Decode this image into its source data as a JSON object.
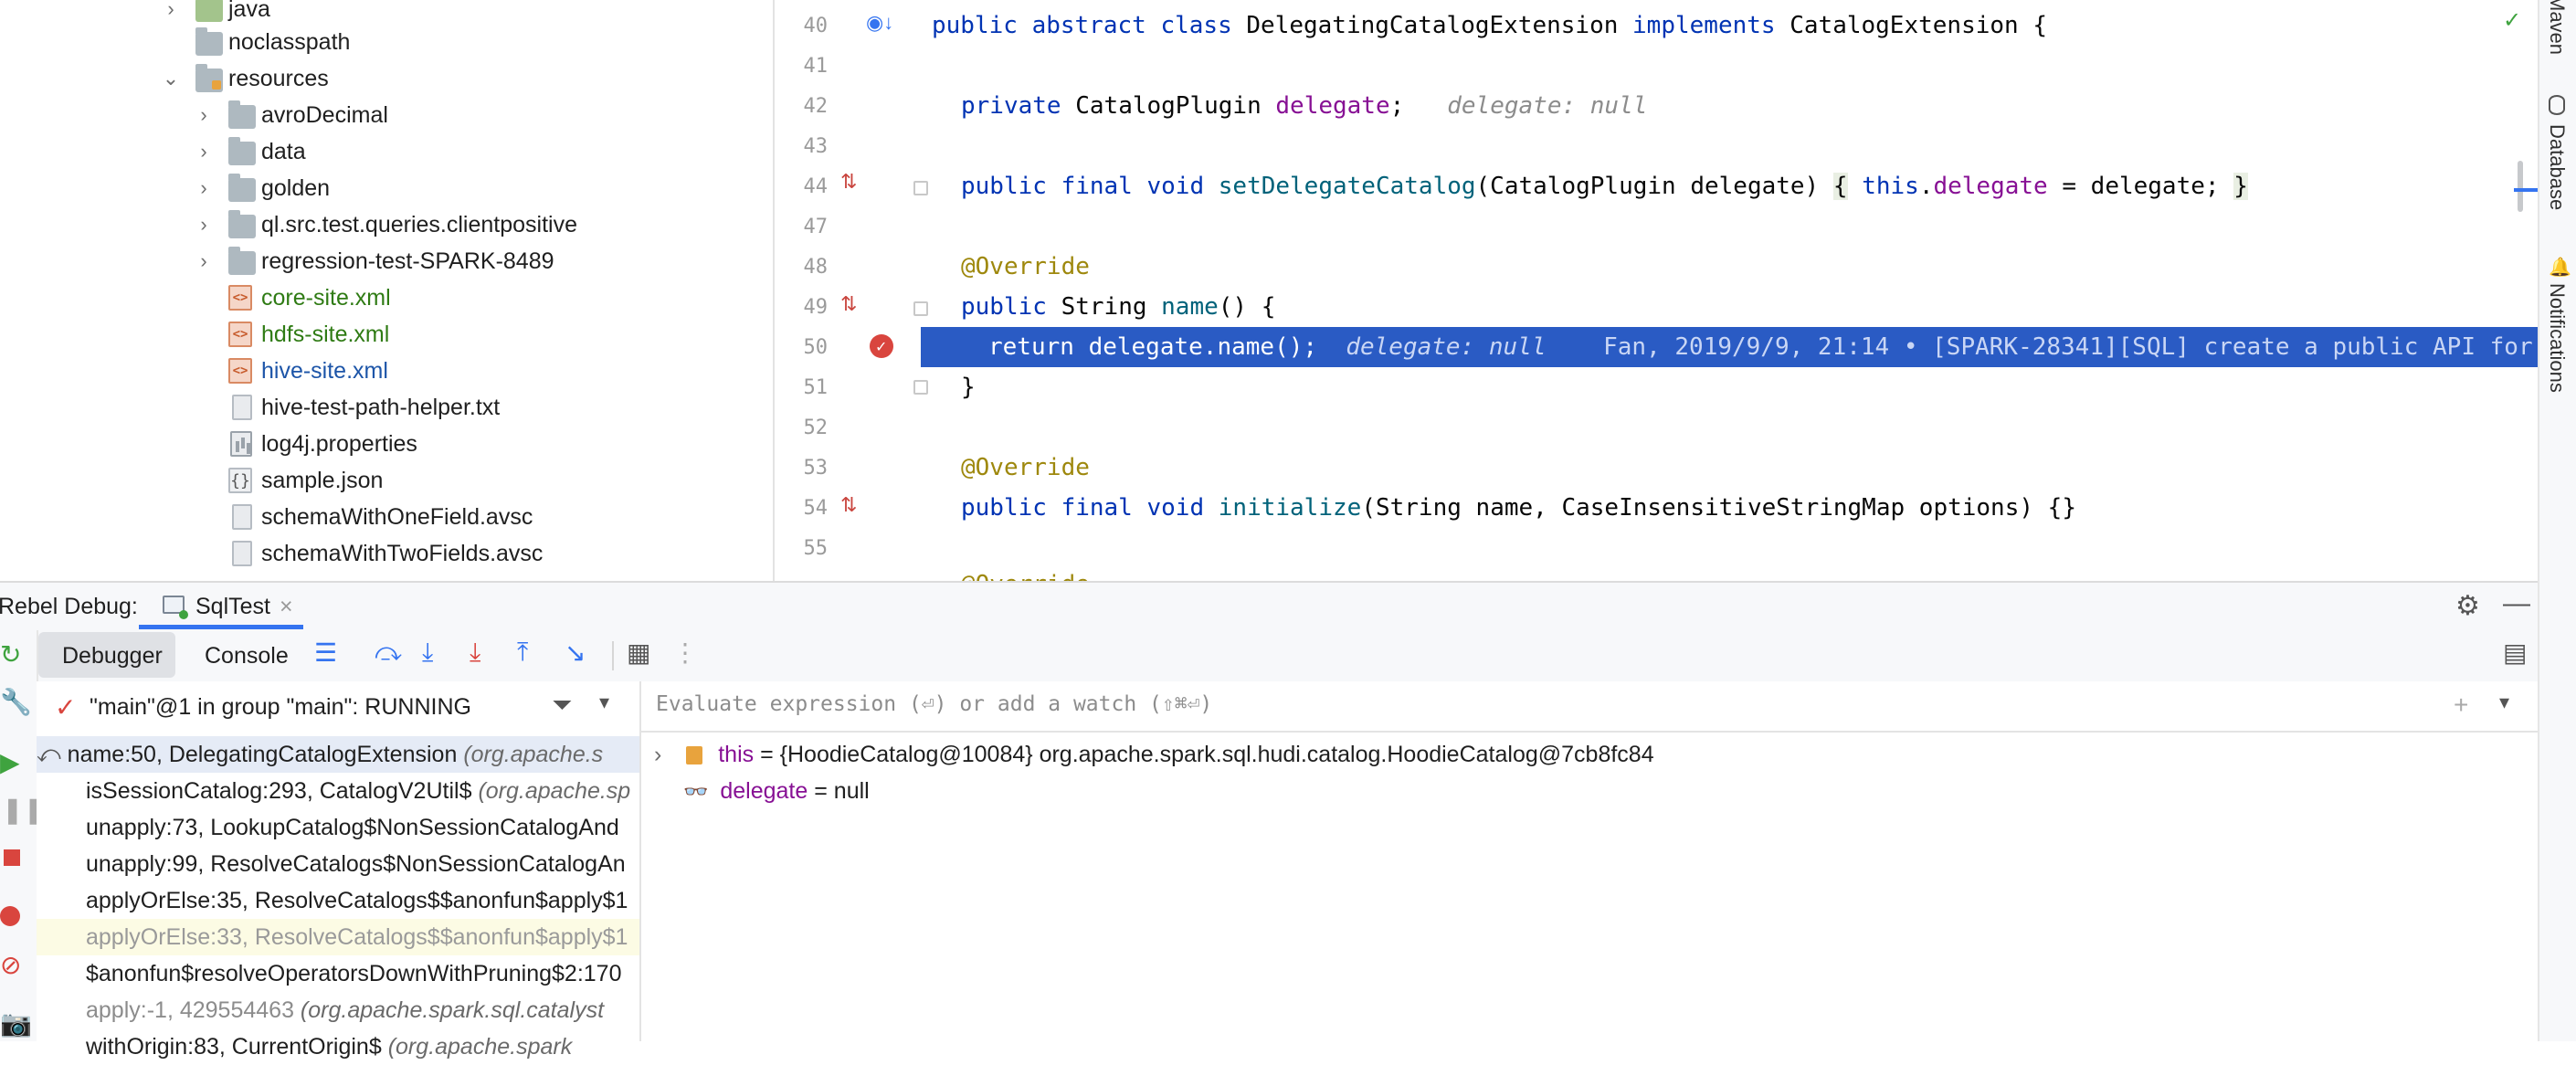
{
  "tree": {
    "items": [
      {
        "label": "java",
        "icon": "folder-green-icon",
        "chevron": "›"
      },
      {
        "label": "noclasspath",
        "icon": "folder-icon",
        "chevron": ""
      },
      {
        "label": "resources",
        "icon": "resources-folder-icon",
        "chevron": "⌄"
      },
      {
        "label": "avroDecimal",
        "icon": "folder-icon",
        "chevron": "›"
      },
      {
        "label": "data",
        "icon": "folder-icon",
        "chevron": "›"
      },
      {
        "label": "golden",
        "icon": "folder-icon",
        "chevron": "›"
      },
      {
        "label": "ql.src.test.queries.clientpositive",
        "icon": "folder-icon",
        "chevron": "›"
      },
      {
        "label": "regression-test-SPARK-8489",
        "icon": "folder-icon",
        "chevron": "›"
      },
      {
        "label": "core-site.xml",
        "icon": "xml-file-icon",
        "chevron": ""
      },
      {
        "label": "hdfs-site.xml",
        "icon": "xml-file-icon",
        "chevron": ""
      },
      {
        "label": "hive-site.xml",
        "icon": "xml-file-icon",
        "chevron": ""
      },
      {
        "label": "hive-test-path-helper.txt",
        "icon": "text-file-icon",
        "chevron": ""
      },
      {
        "label": "log4j.properties",
        "icon": "properties-file-icon",
        "chevron": ""
      },
      {
        "label": "sample.json",
        "icon": "json-file-icon",
        "chevron": ""
      },
      {
        "label": "schemaWithOneField.avsc",
        "icon": "text-file-icon",
        "chevron": ""
      },
      {
        "label": "schemaWithTwoFields.avsc",
        "icon": "text-file-icon",
        "chevron": ""
      }
    ]
  },
  "editor": {
    "line_numbers": [
      "40",
      "41",
      "42",
      "43",
      "44",
      "47",
      "48",
      "49",
      "50",
      "51",
      "52",
      "53",
      "54",
      "55"
    ],
    "code": {
      "l40_kw": "public abstract class",
      "l40_name": " DelegatingCatalogExtension ",
      "l40_impl": "implements",
      "l40_rest": " CatalogExtension {",
      "l42_kw": "private",
      "l42_type": " CatalogPlugin ",
      "l42_field": "delegate",
      "l42_end": ";",
      "l42_hint": "delegate: null",
      "l44_kw": "public final void",
      "l44_fn": "setDelegateCatalog",
      "l44_args": "(CatalogPlugin delegate) ",
      "l44_ob": "{",
      "l44_this": "this",
      "l44_dot": ".",
      "l44_field": "delegate",
      "l44_rest": " = delegate; ",
      "l44_cb": "}",
      "l48_ann": "@Override",
      "l49_kw": "public",
      "l49_type": " String ",
      "l49_fn": "name",
      "l49_rest": "() {",
      "l50_code": "return delegate.name();",
      "l50_hint": "delegate: null",
      "l50_blame": "Fan, 2019/9/9, 21:14 • [SPARK-28341][SQL] create a public API for",
      "l51_code": "}",
      "l53_ann": "@Override",
      "l54_kw": "public final void",
      "l54_fn": "initialize",
      "l54_rest": "(String name, CaseInsensitiveStringMap options) {}",
      "l55_ann": "@Override"
    }
  },
  "right_stripe": {
    "maven": "Maven",
    "database": "Database",
    "notifications": "Notifications"
  },
  "debug": {
    "panel_title": "Rebel Debug:",
    "session_tab": "SqlTest",
    "tabs": {
      "debugger": "Debugger",
      "console": "Console"
    },
    "thread": "\"main\"@1 in group \"main\": RUNNING",
    "eval_placeholder": "Evaluate expression (⏎) or add a watch (⇧⌘⏎)",
    "frames": [
      {
        "method": "name:50, DelegatingCatalogExtension",
        "pkg": "(org.apache.s"
      },
      {
        "method": "isSessionCatalog:293, CatalogV2Util$",
        "pkg": "(org.apache.sp"
      },
      {
        "method": "unapply:73, LookupCatalog$NonSessionCatalogAnd",
        "pkg": ""
      },
      {
        "method": "unapply:99, ResolveCatalogs$NonSessionCatalogAn",
        "pkg": ""
      },
      {
        "method": "applyOrElse:35, ResolveCatalogs$$anonfun$apply$1",
        "pkg": ""
      },
      {
        "method": "applyOrElse:33, ResolveCatalogs$$anonfun$apply$1",
        "pkg": ""
      },
      {
        "method": "$anonfun$resolveOperatorsDownWithPruning$2:170",
        "pkg": ""
      },
      {
        "method": "apply:-1, 429554463",
        "pkg": "(org.apache.spark.sql.catalyst"
      },
      {
        "method": "withOrigin:83, CurrentOrigin$",
        "pkg": "(org.apache.spark"
      }
    ],
    "variables": [
      {
        "name": "this",
        "value": " = {HoodieCatalog@10084} org.apache.spark.sql.hudi.catalog.HoodieCatalog@7cb8fc84"
      },
      {
        "name": "delegate",
        "value": " = null"
      }
    ]
  }
}
